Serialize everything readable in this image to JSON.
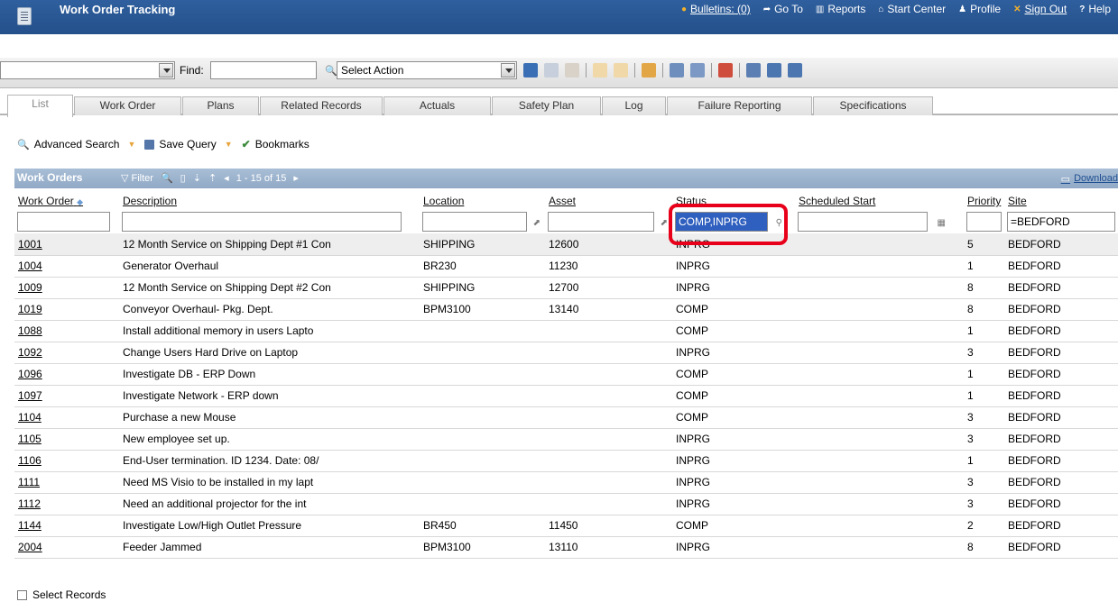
{
  "header": {
    "app_title": "Work Order Tracking",
    "nav": [
      {
        "label": "Bulletins: (0)",
        "icon": "bulletin-icon"
      },
      {
        "label": "Go To",
        "icon": "goto-icon"
      },
      {
        "label": "Reports",
        "icon": "reports-icon"
      },
      {
        "label": "Start Center",
        "icon": "start-center-icon"
      },
      {
        "label": "Profile",
        "icon": "profile-icon"
      },
      {
        "label": "Sign Out",
        "icon": "sign-out-icon"
      },
      {
        "label": "Help",
        "icon": "help-icon"
      }
    ]
  },
  "toolbar": {
    "find_label": "Find:",
    "find_value": "",
    "select_action": "Select Action"
  },
  "tabs": [
    "List",
    "Work Order",
    "Plans",
    "Related Records",
    "Actuals",
    "Safety Plan",
    "Log",
    "Failure Reporting",
    "Specifications"
  ],
  "active_tab": "List",
  "querybar": {
    "advanced_search": "Advanced Search",
    "save_query": "Save Query",
    "bookmarks": "Bookmarks"
  },
  "table": {
    "title": "Work Orders",
    "filter_label": "Filter",
    "paging": "1 - 15 of 15",
    "download": "Download",
    "columns": [
      "Work Order",
      "Description",
      "Location",
      "Asset",
      "Status",
      "Scheduled Start",
      "Priority",
      "Site"
    ],
    "filters": {
      "work_order": "",
      "description": "",
      "location": "",
      "asset": "",
      "status": "COMP,INPRG",
      "scheduled_start": "",
      "priority": "",
      "site": "=BEDFORD"
    },
    "rows": [
      [
        "1001",
        "12 Month Service on Shipping Dept #1 Con",
        "SHIPPING",
        "12600",
        "INPRG",
        "",
        "5",
        "BEDFORD"
      ],
      [
        "1004",
        "Generator Overhaul",
        "BR230",
        "11230",
        "INPRG",
        "",
        "1",
        "BEDFORD"
      ],
      [
        "1009",
        "12 Month Service on Shipping Dept #2 Con",
        "SHIPPING",
        "12700",
        "INPRG",
        "",
        "8",
        "BEDFORD"
      ],
      [
        "1019",
        "Conveyor Overhaul- Pkg. Dept.",
        "BPM3100",
        "13140",
        "COMP",
        "",
        "8",
        "BEDFORD"
      ],
      [
        "1088",
        "Install additional memory in users Lapto",
        "",
        "",
        "COMP",
        "",
        "1",
        "BEDFORD"
      ],
      [
        "1092",
        "Change Users Hard Drive on Laptop",
        "",
        "",
        "INPRG",
        "",
        "3",
        "BEDFORD"
      ],
      [
        "1096",
        "Investigate DB - ERP Down",
        "",
        "",
        "COMP",
        "",
        "1",
        "BEDFORD"
      ],
      [
        "1097",
        "Investigate Network - ERP down",
        "",
        "",
        "COMP",
        "",
        "1",
        "BEDFORD"
      ],
      [
        "1104",
        "Purchase a new Mouse",
        "",
        "",
        "COMP",
        "",
        "3",
        "BEDFORD"
      ],
      [
        "1105",
        "New employee set up.",
        "",
        "",
        "INPRG",
        "",
        "3",
        "BEDFORD"
      ],
      [
        "1106",
        "End-User termination. ID 1234. Date: 08/",
        "",
        "",
        "INPRG",
        "",
        "1",
        "BEDFORD"
      ],
      [
        "1111",
        "Need MS Visio to be installed in my lapt",
        "",
        "",
        "INPRG",
        "",
        "3",
        "BEDFORD"
      ],
      [
        "1112",
        "Need an additional projector for the int",
        "",
        "",
        "INPRG",
        "",
        "3",
        "BEDFORD"
      ],
      [
        "1144",
        "Investigate Low/High Outlet Pressure",
        "BR450",
        "11450",
        "COMP",
        "",
        "2",
        "BEDFORD"
      ],
      [
        "2004",
        "Feeder Jammed",
        "BPM3100",
        "13110",
        "INPRG",
        "",
        "8",
        "BEDFORD"
      ]
    ],
    "select_records": "Select Records"
  },
  "colors": {
    "title_bar": "#2f5f9e",
    "band": "#a9bed6",
    "highlight": "#e8001a"
  }
}
